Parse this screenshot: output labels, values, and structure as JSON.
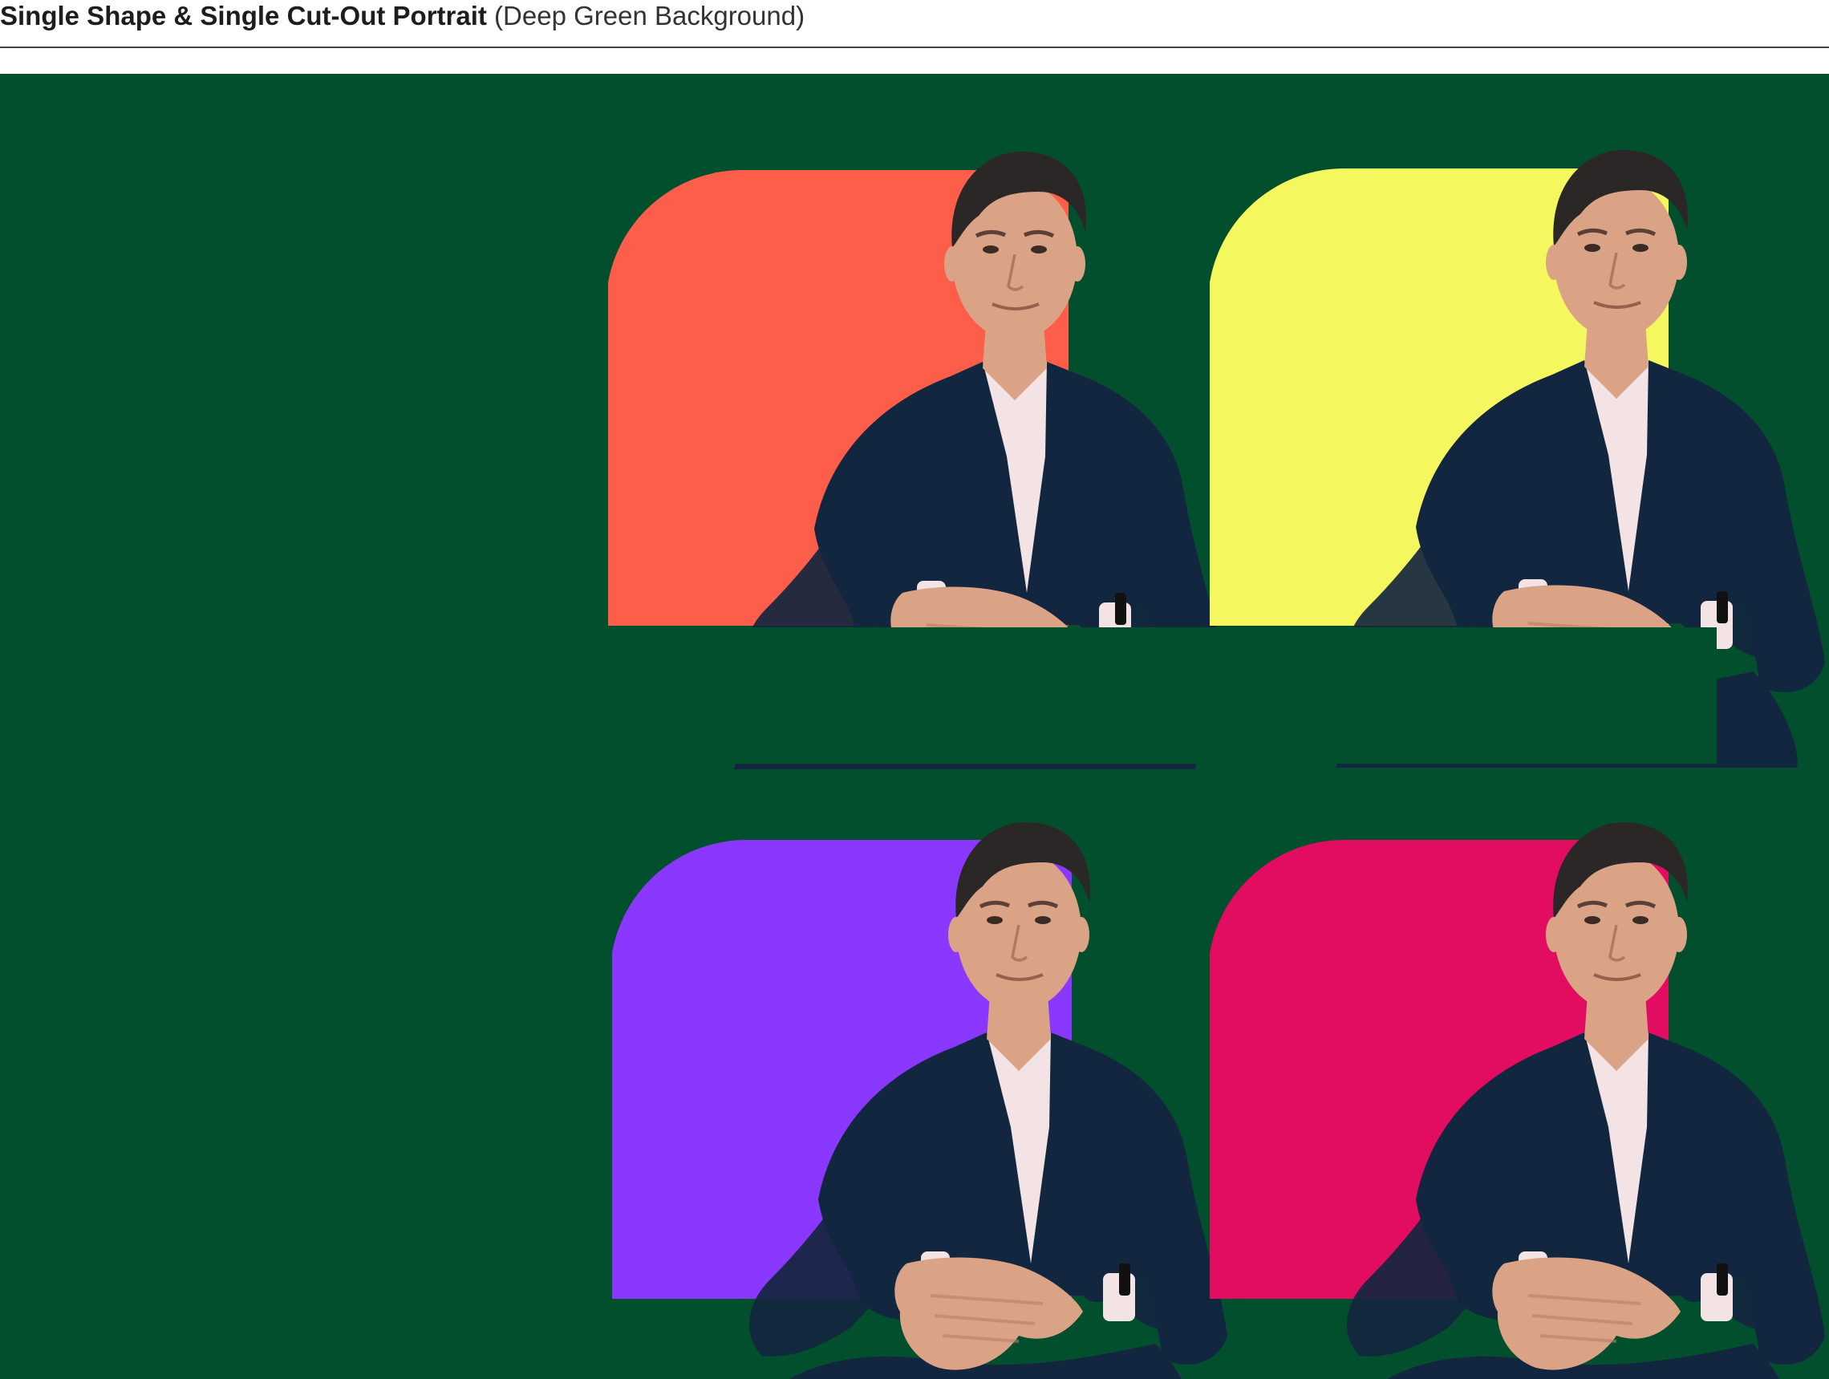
{
  "header": {
    "title_bold": "Single Shape & Single Cut-Out Portrait",
    "title_light": "(Deep Green Background)"
  },
  "colors": {
    "background": "#024f2d",
    "shape_1": "#fd5e49",
    "shape_2": "#f5f75f",
    "shape_3": "#8a38fd",
    "shape_4": "#e20c60",
    "suit": "#13263f",
    "shirt": "#f3e3e4",
    "skin": "#dba386",
    "hair": "#2b2726"
  },
  "tiles": [
    {
      "name": "portrait-tile-red",
      "shape_color_key": "shape_1"
    },
    {
      "name": "portrait-tile-yellow",
      "shape_color_key": "shape_2"
    },
    {
      "name": "portrait-tile-purple",
      "shape_color_key": "shape_3"
    },
    {
      "name": "portrait-tile-pink",
      "shape_color_key": "shape_4"
    }
  ]
}
